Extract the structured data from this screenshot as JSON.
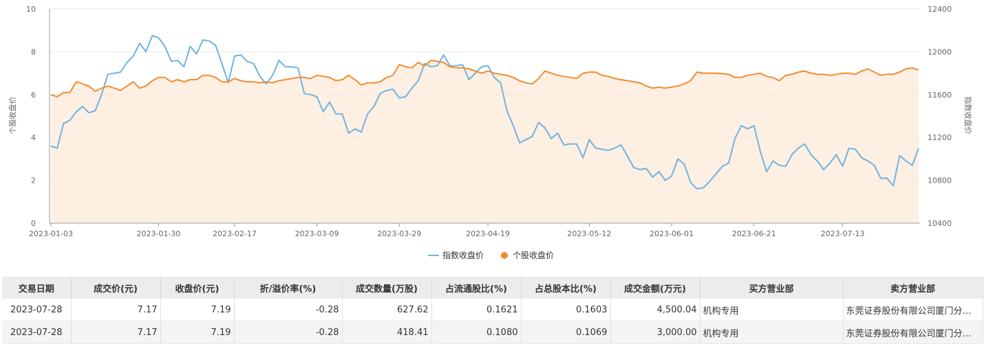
{
  "chart_data": {
    "type": "line",
    "x_ticks": [
      "2023-01-03",
      "2023-01-30",
      "2023-02-17",
      "2023-03-09",
      "2023-03-29",
      "2023-04-19",
      "2023-05-12",
      "2023-06-01",
      "2023-06-21",
      "2023-07-13"
    ],
    "y_left": {
      "label": "个股收盘价",
      "ticks": [
        "0",
        "2",
        "4",
        "6",
        "8",
        "10"
      ],
      "range": [
        0,
        10
      ]
    },
    "y_right": {
      "label": "指数收盘价",
      "ticks": [
        "10400",
        "10800",
        "11200",
        "11600",
        "12000",
        "12400"
      ],
      "range": [
        10400,
        12400
      ]
    },
    "legend": {
      "position": "bottom"
    },
    "series": [
      {
        "name": "指数收盘价",
        "axis": "right",
        "color": "#6fb3e0",
        "values": [
          11120,
          11100,
          11330,
          11360,
          11440,
          11490,
          11430,
          11450,
          11600,
          11790,
          11800,
          11810,
          11900,
          11960,
          12080,
          12000,
          12150,
          12130,
          12050,
          11910,
          11920,
          11860,
          12050,
          11980,
          12110,
          12100,
          12060,
          11890,
          11710,
          11960,
          11970,
          11910,
          11890,
          11770,
          11700,
          11780,
          11920,
          11860,
          11860,
          11850,
          11610,
          11600,
          11580,
          11440,
          11530,
          11420,
          11420,
          11240,
          11280,
          11250,
          11420,
          11490,
          11610,
          11640,
          11650,
          11570,
          11580,
          11660,
          11730,
          11890,
          11860,
          11870,
          11970,
          11870,
          11870,
          11880,
          11740,
          11800,
          11860,
          11870,
          11760,
          11710,
          11450,
          11310,
          11150,
          11180,
          11210,
          11340,
          11290,
          11190,
          11240,
          11130,
          11140,
          11140,
          11010,
          11180,
          11100,
          11090,
          11080,
          11100,
          11130,
          11030,
          10920,
          10900,
          10910,
          10830,
          10880,
          10800,
          10840,
          11000,
          10950,
          10780,
          10720,
          10730,
          10790,
          10860,
          10930,
          10960,
          11190,
          11310,
          11280,
          11310,
          11070,
          10880,
          10980,
          10940,
          10930,
          11040,
          11100,
          11140,
          11040,
          10980,
          10900,
          10960,
          11040,
          10930,
          11100,
          11090,
          11010,
          10980,
          10940,
          10820,
          10820,
          10750,
          11030,
          10980,
          10940,
          11100
        ]
      },
      {
        "name": "个股收盘价",
        "axis": "left",
        "color": "#f28b30",
        "values": [
          6.0,
          5.9,
          6.1,
          6.1,
          6.6,
          6.5,
          6.4,
          6.15,
          6.3,
          6.4,
          6.3,
          6.2,
          6.4,
          6.6,
          6.3,
          6.4,
          6.65,
          6.8,
          6.8,
          6.6,
          6.7,
          6.6,
          6.7,
          6.7,
          6.9,
          6.9,
          6.8,
          6.6,
          6.6,
          6.75,
          6.65,
          6.6,
          6.6,
          6.55,
          6.6,
          6.55,
          6.65,
          6.7,
          6.75,
          6.8,
          6.8,
          6.75,
          6.9,
          6.85,
          6.8,
          6.65,
          6.7,
          6.9,
          6.7,
          6.45,
          6.55,
          6.55,
          6.6,
          6.8,
          6.9,
          7.4,
          7.3,
          7.25,
          7.5,
          7.35,
          7.6,
          7.55,
          7.5,
          7.3,
          7.25,
          7.25,
          7.2,
          7.1,
          7.0,
          7.1,
          7.0,
          6.95,
          6.9,
          6.8,
          6.65,
          6.55,
          6.5,
          6.75,
          7.1,
          7.0,
          6.9,
          6.85,
          6.8,
          6.75,
          7.0,
          7.05,
          7.05,
          6.9,
          6.85,
          6.75,
          6.7,
          6.65,
          6.6,
          6.55,
          6.4,
          6.3,
          6.35,
          6.3,
          6.35,
          6.4,
          6.5,
          6.65,
          7.05,
          7.0,
          7.0,
          7.0,
          6.98,
          6.95,
          6.8,
          6.8,
          6.9,
          6.95,
          7.0,
          6.85,
          6.8,
          6.65,
          6.9,
          6.95,
          7.05,
          7.1,
          7.0,
          6.95,
          6.95,
          6.9,
          6.95,
          7.0,
          7.0,
          6.95,
          7.1,
          7.2,
          7.05,
          6.9,
          6.95,
          6.95,
          7.05,
          7.2,
          7.25,
          7.15,
          7.18,
          7.2
        ]
      }
    ]
  },
  "table": {
    "headers": [
      "交易日期",
      "成交价(元)",
      "收盘价(元)",
      "折/溢价率(%)",
      "成交数量(万股)",
      "占流通股比(%)",
      "占总股本比(%)",
      "成交金额(万元)",
      "买方营业部",
      "卖方营业部"
    ],
    "rows": [
      [
        "2023-07-28",
        "7.17",
        "7.19",
        "-0.28",
        "627.62",
        "0.1621",
        "0.1603",
        "4,500.04",
        "机构专用",
        "东莞证券股份有限公司厦门分公司"
      ],
      [
        "2023-07-28",
        "7.17",
        "7.19",
        "-0.28",
        "418.41",
        "0.1080",
        "0.1069",
        "3,000.00",
        "机构专用",
        "东莞证券股份有限公司厦门分公司"
      ]
    ]
  }
}
